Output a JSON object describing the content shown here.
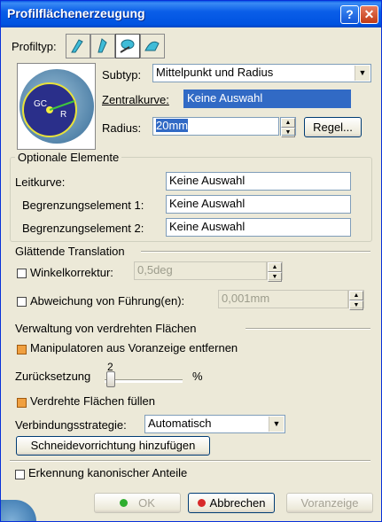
{
  "window": {
    "title": "Profilflächenerzeugung",
    "help_label": "?",
    "close_label": "✕"
  },
  "profiltyp": {
    "label": "Profiltyp:",
    "icons": [
      "profile-type-1-icon",
      "profile-type-2-icon",
      "profile-type-3-icon",
      "profile-type-4-icon"
    ]
  },
  "subtyp": {
    "label": "Subtyp:",
    "value": "Mittelpunkt und Radius"
  },
  "zentralkurve": {
    "label": "Zentralkurve:",
    "value": "Keine Auswahl"
  },
  "radius": {
    "label": "Radius:",
    "value": "20mm",
    "law_button": "Regel..."
  },
  "diagram": {
    "gc": "GC",
    "r": "R"
  },
  "optionale": {
    "legend": "Optionale Elemente",
    "leitkurve_label": "Leitkurve:",
    "leitkurve_value": "Keine Auswahl",
    "begr1_label": "Begrenzungselement 1:",
    "begr1_value": "Keine Auswahl",
    "begr2_label": "Begrenzungselement 2:",
    "begr2_value": "Keine Auswahl"
  },
  "glaettend": {
    "title": "Glättende Translation",
    "winkel_label": "Winkelkorrektur:",
    "winkel_value": "0,5deg",
    "abweichung_label": "Abweichung von Führung(en):",
    "abweichung_value": "0,001mm"
  },
  "verwaltung": {
    "title": "Verwaltung von verdrehten Flächen",
    "manip_label": "Manipulatoren aus Voranzeige entfernen",
    "zurueck_label": "Zurücksetzung",
    "zurueck_value": "2",
    "zurueck_unit": "%",
    "verdreht_label": "Verdrehte Flächen füllen",
    "strategie_label": "Verbindungsstrategie:",
    "strategie_value": "Automatisch",
    "schneide_button": "Schneidevorrichtung hinzufügen"
  },
  "erkennung_label": "Erkennung kanonischer Anteile",
  "buttons": {
    "ok": "OK",
    "cancel": "Abbrechen",
    "preview": "Voranzeige"
  },
  "colors": {
    "title_blue": "#0053e1",
    "selection": "#316ac5",
    "checkbox_checked": "#f0a040"
  }
}
